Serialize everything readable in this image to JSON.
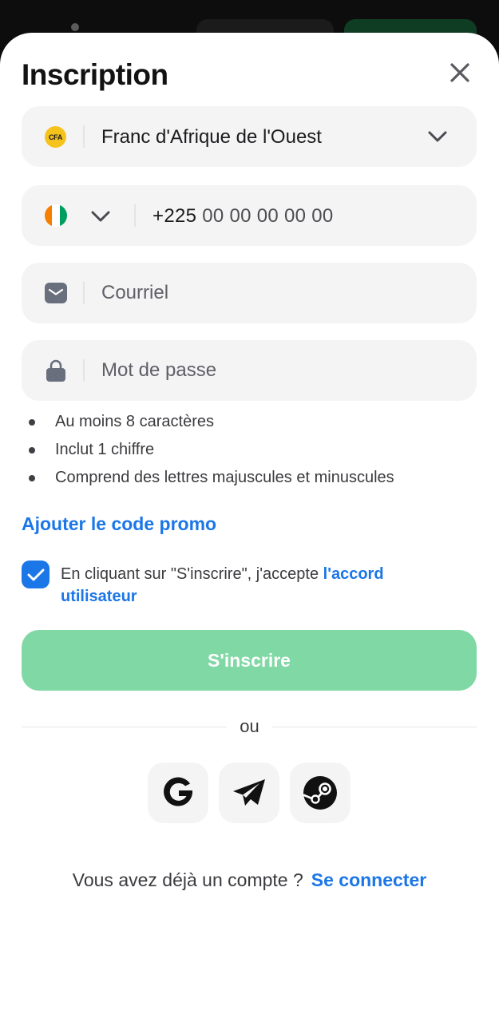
{
  "dialog": {
    "title": "Inscription"
  },
  "currency": {
    "badge": "CFA",
    "label": "Franc d'Afrique de l'Ouest"
  },
  "phone": {
    "country": "Côte d'Ivoire",
    "code": "+225",
    "placeholder": "00 00 00 00 00",
    "flag_colors": [
      "#f77f00",
      "#ffffff",
      "#009e60"
    ]
  },
  "email": {
    "placeholder": "Courriel"
  },
  "password": {
    "placeholder": "Mot de passe",
    "rules": [
      "Au moins 8 caractères",
      "Inclut 1 chiffre",
      "Comprend des lettres majuscules et minuscules"
    ]
  },
  "promo": {
    "label": "Ajouter le code promo"
  },
  "consent": {
    "checked": true,
    "text": "En cliquant sur \"S'inscrire\", j'accepte ",
    "link": "l'accord utilisateur"
  },
  "submit": {
    "label": "S'inscrire"
  },
  "separator": {
    "label": "ou"
  },
  "social": [
    {
      "name": "google",
      "icon": "google-icon"
    },
    {
      "name": "telegram",
      "icon": "telegram-icon"
    },
    {
      "name": "steam",
      "icon": "steam-icon"
    }
  ],
  "footer": {
    "question": "Vous avez déjà un compte ?",
    "link": "Se connecter"
  },
  "colors": {
    "accent": "#1b76e8",
    "submit_disabled": "#80d8a5",
    "field_bg": "#f4f4f5"
  }
}
